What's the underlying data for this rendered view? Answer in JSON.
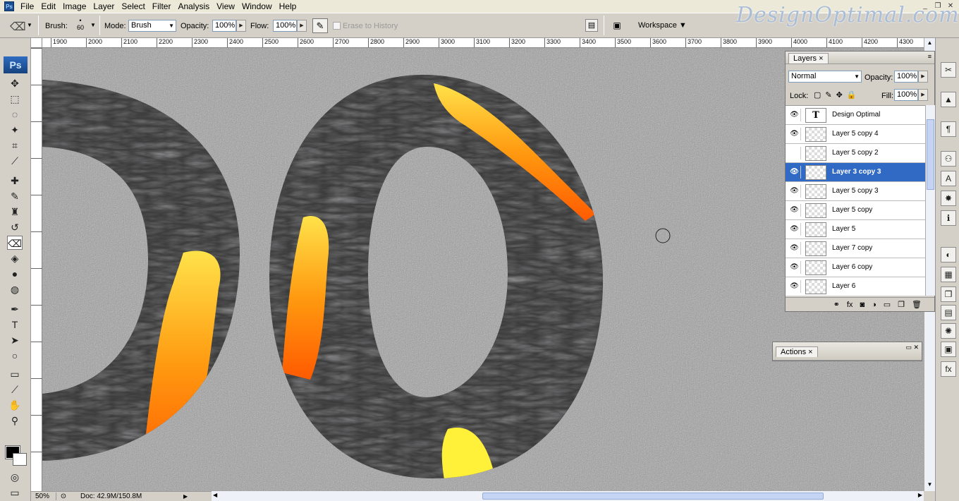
{
  "app": {
    "logo_text": "Ps",
    "watermark": "DesignOptimal.com"
  },
  "menus": [
    "File",
    "Edit",
    "Image",
    "Layer",
    "Select",
    "Filter",
    "Analysis",
    "View",
    "Window",
    "Help"
  ],
  "window_buttons": [
    "_",
    "❐",
    "✕"
  ],
  "options": {
    "brush_label": "Brush:",
    "brush_size": "60",
    "mode_label": "Mode:",
    "mode_value": "Brush",
    "opacity_label": "Opacity:",
    "opacity_value": "100%",
    "flow_label": "Flow:",
    "flow_value": "100%",
    "erase_history_label": "Erase to History",
    "workspace_label": "Workspace ▼"
  },
  "ruler": {
    "ticks": [
      "1900",
      "2000",
      "2100",
      "2200",
      "2300",
      "2400",
      "2500",
      "2600",
      "2700",
      "2800",
      "2900",
      "3000",
      "3100",
      "3200",
      "3300",
      "3400",
      "3500",
      "3600",
      "3700",
      "3800",
      "3900",
      "4000",
      "4100",
      "4200",
      "4300"
    ]
  },
  "status": {
    "zoom": "50%",
    "doc": "Doc: 42.9M/150.8M"
  },
  "layers_panel": {
    "tab_label": "Layers",
    "blend_mode": "Normal",
    "opacity_label": "Opacity:",
    "opacity_value": "100%",
    "lock_label": "Lock:",
    "fill_label": "Fill:",
    "fill_value": "100%",
    "layers": [
      {
        "name": "Design Optimal",
        "visible": true,
        "selected": false,
        "type": "text"
      },
      {
        "name": "Layer 5 copy 4",
        "visible": true,
        "selected": false,
        "type": "pixel"
      },
      {
        "name": "Layer 5 copy 2",
        "visible": false,
        "selected": false,
        "type": "pixel"
      },
      {
        "name": "Layer 3 copy 3",
        "visible": true,
        "selected": true,
        "type": "pixel"
      },
      {
        "name": "Layer 5 copy 3",
        "visible": true,
        "selected": false,
        "type": "pixel"
      },
      {
        "name": "Layer 5 copy",
        "visible": true,
        "selected": false,
        "type": "pixel"
      },
      {
        "name": "Layer 5",
        "visible": true,
        "selected": false,
        "type": "pixel"
      },
      {
        "name": "Layer 7 copy",
        "visible": true,
        "selected": false,
        "type": "pixel"
      },
      {
        "name": "Layer 6 copy",
        "visible": true,
        "selected": false,
        "type": "pixel"
      },
      {
        "name": "Layer 6",
        "visible": true,
        "selected": false,
        "type": "pixel"
      }
    ],
    "footer_icons": [
      "link-icon",
      "fx-icon",
      "mask-icon",
      "adjustment-icon",
      "folder-icon",
      "new-layer-icon",
      "trash-icon"
    ]
  },
  "actions_panel": {
    "tab_label": "Actions"
  },
  "colors": {
    "selection": "#316ac5",
    "background_grey": "#9b9b9b",
    "lava": "#ff8a00"
  }
}
